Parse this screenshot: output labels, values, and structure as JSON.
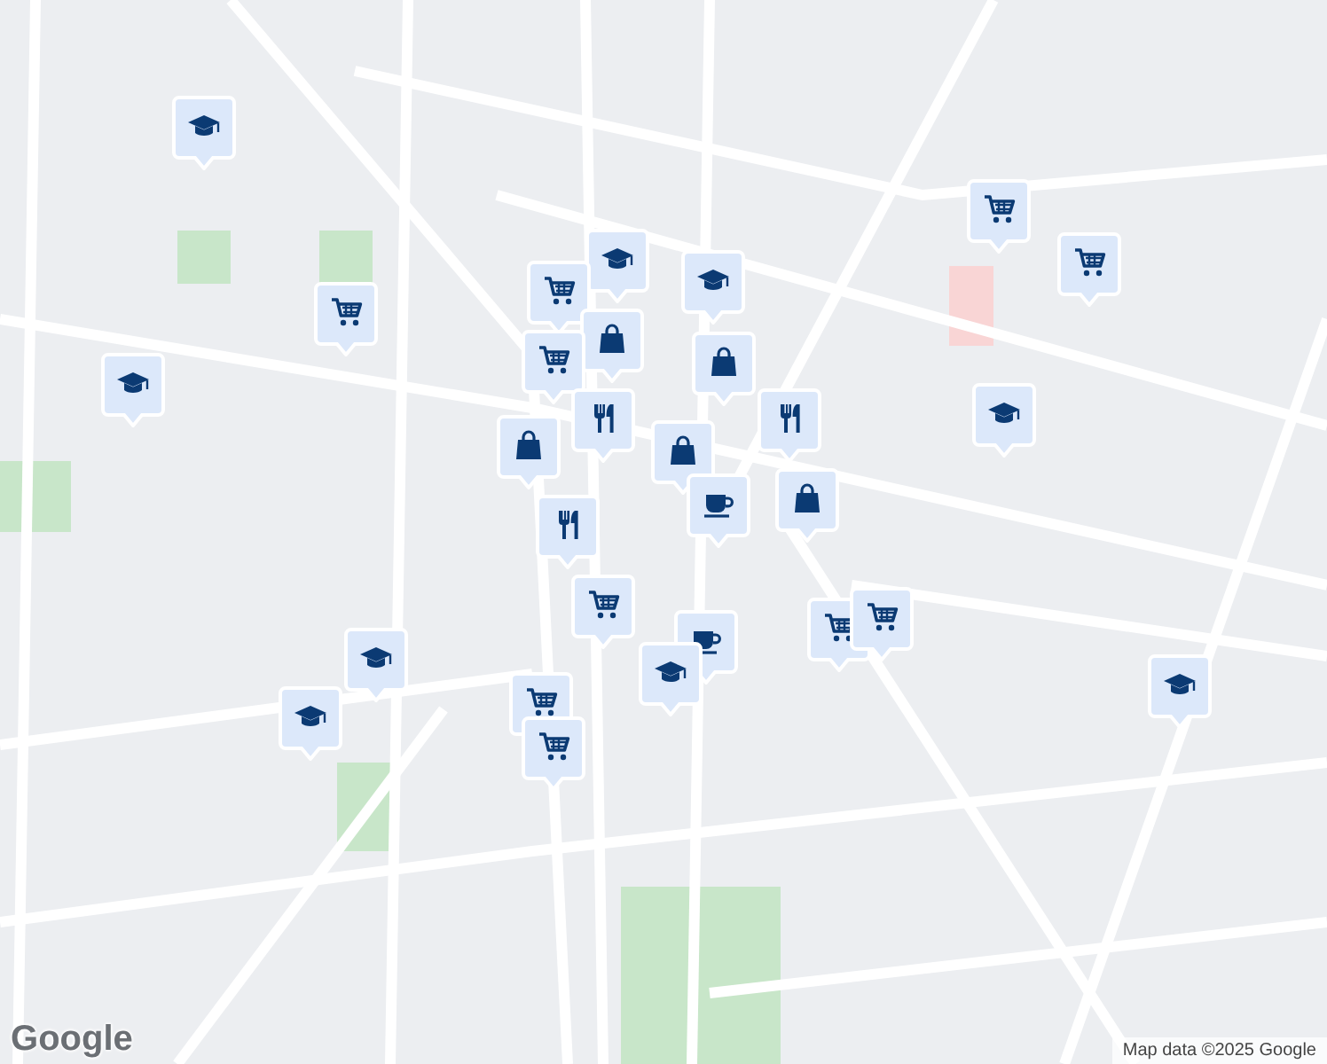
{
  "map": {
    "markers": [
      {
        "kind": "school"
      },
      {
        "kind": "cart"
      },
      {
        "kind": "school"
      },
      {
        "kind": "school"
      },
      {
        "kind": "cart"
      },
      {
        "kind": "bag"
      },
      {
        "kind": "cart"
      },
      {
        "kind": "restaurant"
      },
      {
        "kind": "bag"
      },
      {
        "kind": "restaurant"
      },
      {
        "kind": "school"
      },
      {
        "kind": "bag"
      },
      {
        "kind": "bag"
      },
      {
        "kind": "restaurant"
      },
      {
        "kind": "cup"
      },
      {
        "kind": "bag"
      },
      {
        "kind": "cart"
      },
      {
        "kind": "cup"
      },
      {
        "kind": "school"
      },
      {
        "kind": "cart"
      },
      {
        "kind": "cart"
      },
      {
        "kind": "school"
      },
      {
        "kind": "school"
      },
      {
        "kind": "cart"
      },
      {
        "kind": "cart"
      },
      {
        "kind": "cart"
      },
      {
        "kind": "cart"
      },
      {
        "kind": "school"
      },
      {
        "kind": "school"
      }
    ]
  },
  "logo": "Google",
  "attribution": "Map data ©2025 Google"
}
